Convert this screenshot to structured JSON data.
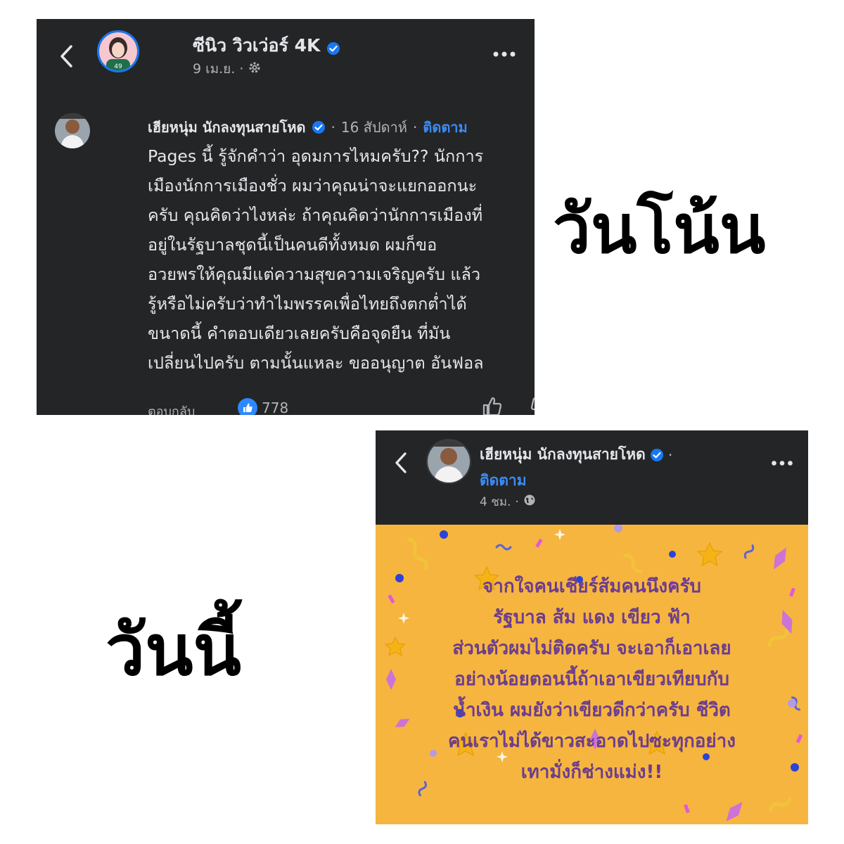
{
  "top_post": {
    "page_name": "ซีนิว วิวเว่อร์ 4K",
    "date": "9 เม.ย.",
    "separator": "·",
    "comment": {
      "author": "เฮียหนุ่ม นักลงทุนสายโหด",
      "time": "16 สัปดาห์",
      "follow_label": "ติดตาม",
      "lines": [
        "Pages นี้ รู้จักคำว่า อุดมการไหมครับ?? นักการ",
        "เมืองนักการเมืองชั่ว ผมว่าคุณน่าจะแยกออกนะ",
        "ครับ คุณคิดว่าไงหล่ะ ถ้าคุณคิดว่านักการเมืองที่",
        "อยู่ในรัฐบาลชุดนี้เป็นคนดีทั้งหมด ผมก็ขอ",
        "อวยพรให้คุณมีแต่ความสุขความเจริญครับ แล้ว",
        "รู้หรือไม่ครับว่าทำไมพรรคเพื่อไทยถึงตกต่ำได้",
        "ขนาดนี้ คำตอบเดียวเลยครับคือจุดยืน ที่มัน",
        "เปลี่ยนไปครับ ตามนั้นแหละ ขออนุญาต อันฟอล"
      ],
      "reply_label": "ตอบกลับ",
      "like_count": "778"
    }
  },
  "labels": {
    "then": "วันโน้น",
    "now": "วันนี้"
  },
  "bottom_post": {
    "author": "เฮียหนุ่ม นักลงทุนสายโหด",
    "separator": "·",
    "follow_label": "ติดตาม",
    "time": "4 ชม.",
    "lines": [
      "จากใจคนเชียร์ส้มคนนึงครับ",
      "รัฐบาล ส้ม แดง เขียว ฟ้า",
      "ส่วนตัวผมไม่ติดครับ จะเอาก็เอาเลย",
      "อย่างน้อยตอนนี้ถ้าเอาเขียวเทียบกับ",
      "น้ำเงิน ผมยังว่าเขียวดีกว่าครับ ชีวิต",
      "คนเราไม่ได้ขาวสะอาดไปซะทุกอย่าง",
      "เทามั่งก็ช่างแม่ง!!"
    ]
  },
  "colors": {
    "panel_bg": "#242526",
    "text_primary": "#e4e6eb",
    "text_secondary": "#b0b3b8",
    "link_blue": "#3b8bf5",
    "verified_blue": "#1877f2",
    "card_orange": "#f6b53f",
    "card_text_purple": "#6b3d8f"
  },
  "icons": [
    "back-icon",
    "more-icon",
    "verified-icon",
    "gear-icon",
    "globe-icon",
    "like-badge-icon",
    "thumbs-up-icon",
    "thumbs-down-icon"
  ]
}
